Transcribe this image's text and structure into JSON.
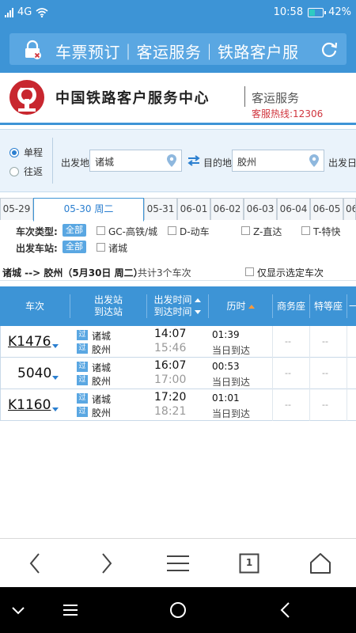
{
  "status_bar": {
    "network": "4G",
    "time": "10:58",
    "battery": "42%",
    "battery_level": 0.42
  },
  "app_bar": {
    "title": "车票预订｜客运服务｜铁路客户服"
  },
  "brand": {
    "name": "中国铁路客户服务中心",
    "sub": "客运服务",
    "hotline": "客服热线:12306"
  },
  "search": {
    "trip_one_way": "单程",
    "trip_round": "往返",
    "from_label": "出发地",
    "from_value": "诸城",
    "to_label": "目的地",
    "to_value": "胶州",
    "date_label": "出发日"
  },
  "dates": [
    {
      "label": "05-29",
      "active": false
    },
    {
      "label": "05-30 周二",
      "active": true
    },
    {
      "label": "05-31",
      "active": false
    },
    {
      "label": "06-01",
      "active": false
    },
    {
      "label": "06-02",
      "active": false
    },
    {
      "label": "06-03",
      "active": false
    },
    {
      "label": "06-04",
      "active": false
    },
    {
      "label": "06-05",
      "active": false
    },
    {
      "label": "06",
      "active": false
    }
  ],
  "filters": {
    "type_label": "车次类型:",
    "all": "全部",
    "types": [
      "GC-高铁/城",
      "D-动车",
      "Z-直达",
      "T-特快"
    ],
    "station_label": "出发车站:",
    "stations": [
      "诸城"
    ]
  },
  "route": {
    "summary": "诸城 --> 胶州（5月30日 周二）",
    "count_text": "共计3个车次",
    "only_selected": "仅显示选定车次"
  },
  "table": {
    "headers": {
      "train": "车次",
      "from_station": "出发站",
      "to_station": "到达站",
      "depart_time": "出发时间",
      "arrive_time": "到达时间",
      "duration": "历时",
      "business": "商务座",
      "special": "特等座",
      "more": "一"
    },
    "pass_tag": "过",
    "rows": [
      {
        "code": "K1476",
        "from": "诸城",
        "to": "胶州",
        "depart": "14:07",
        "arrive": "15:46",
        "duration": "01:39",
        "arrival_note": "当日到达",
        "business": "--",
        "special": "--"
      },
      {
        "code": "5040",
        "from": "诸城",
        "to": "胶州",
        "depart": "16:07",
        "arrive": "17:00",
        "duration": "00:53",
        "arrival_note": "当日到达",
        "business": "--",
        "special": "--"
      },
      {
        "code": "K1160",
        "from": "诸城",
        "to": "胶州",
        "depart": "17:20",
        "arrive": "18:21",
        "duration": "01:01",
        "arrival_note": "当日到达",
        "business": "--",
        "special": "--"
      }
    ]
  },
  "browser_bar": {
    "tab_count": "1"
  },
  "colors": {
    "primary": "#3d94d6",
    "accent_red": "#d0343d",
    "link_blue": "#2b7fd0",
    "sort_orange": "#ff9a3c"
  }
}
